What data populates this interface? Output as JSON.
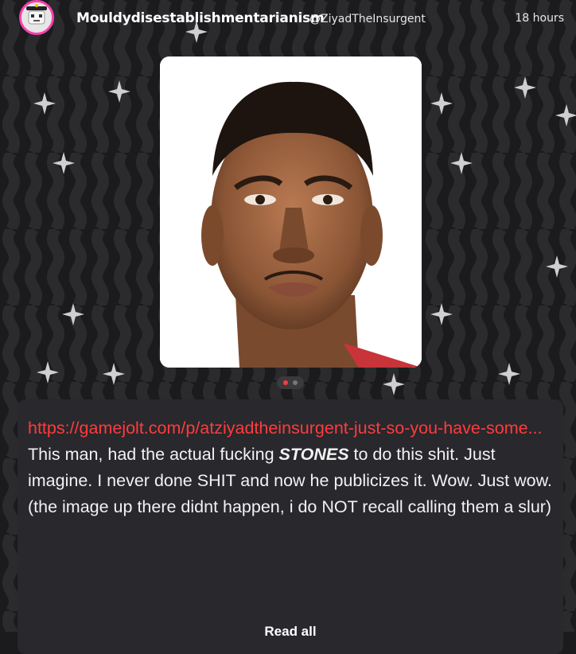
{
  "post": {
    "username": "Mouldydisestablishmentarianism",
    "handle": "@ZiyadTheInsurgent",
    "time": "18 hours"
  },
  "media": {
    "carousel_count": 2,
    "active_index": 1,
    "active_dot_color": "#ff3b3b"
  },
  "body": {
    "link": "https://gamejolt.com/p/atziyadtheinsurgent-just-so-you-have-some...",
    "line1_before": "This man, had the actual fucking ",
    "line1_bold": "STONES",
    "line1_after": " to do this shit. Just imagine. I never done SHIT and now he publicizes it. Wow. Just wow.",
    "line2": "(the image up there didnt happen, i do NOT recall calling them a slur)",
    "read_more": "Read all"
  },
  "colors": {
    "accent_pink": "#ff3fac",
    "link_red": "#ff3c3c",
    "card_bg": "#28282d"
  }
}
